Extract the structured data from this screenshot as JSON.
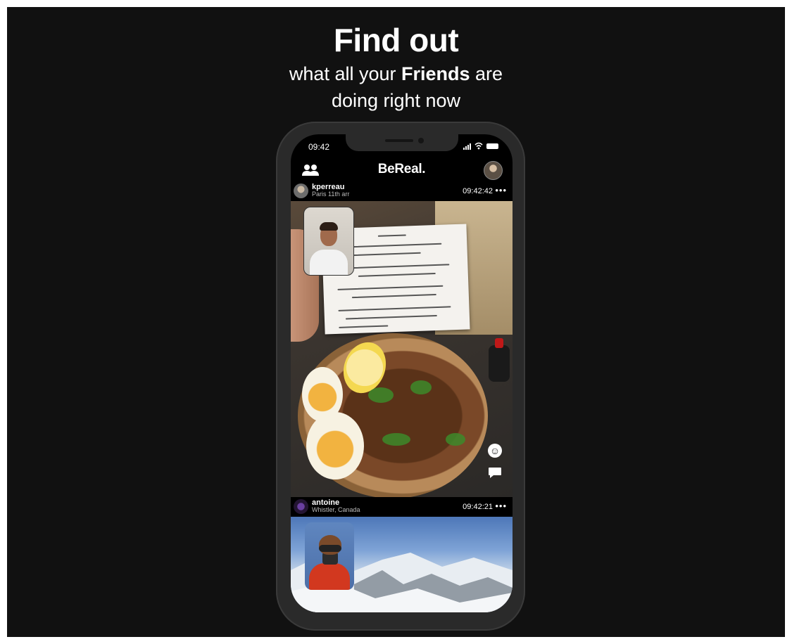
{
  "promo": {
    "title": "Find out",
    "subtitle_pre": "what all your ",
    "subtitle_bold": "Friends",
    "subtitle_post": " are",
    "subtitle_line2": "doing right now"
  },
  "status_bar": {
    "time": "09:42"
  },
  "app": {
    "name": "BeReal."
  },
  "posts": [
    {
      "username": "kperreau",
      "location": "Paris 11th arr",
      "time": "09:42:42",
      "more": "•••"
    },
    {
      "username": "antoine",
      "location": "Whistler, Canada",
      "time": "09:42:21",
      "more": "•••"
    }
  ],
  "icons": {
    "friends": "friends-icon",
    "profile": "profile-avatar",
    "react": "smiley-icon",
    "comment": "comment-icon"
  },
  "colors": {
    "background": "#111111",
    "text": "#ffffff"
  }
}
